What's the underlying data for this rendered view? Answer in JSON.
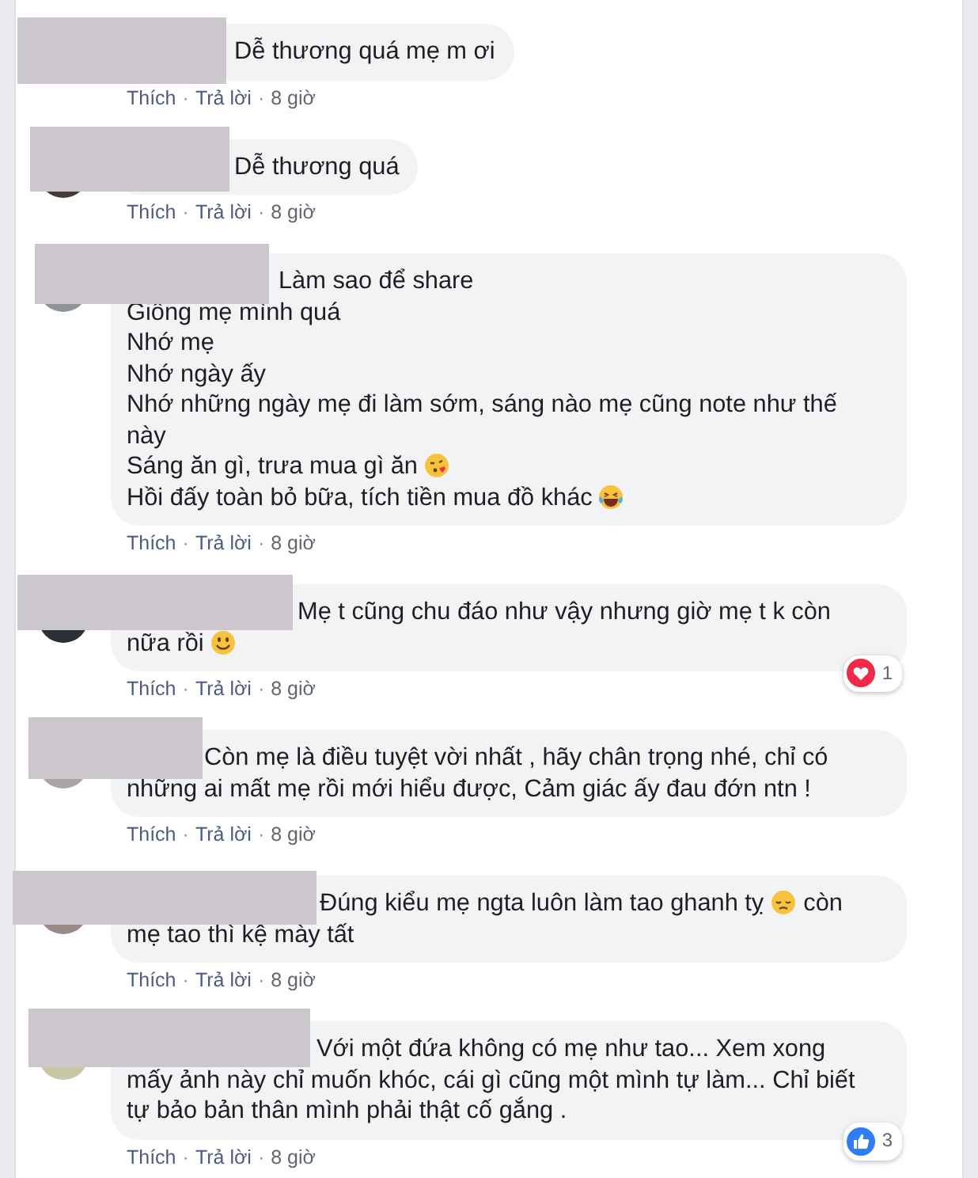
{
  "comments": [
    {
      "lines": [
        [
          {
            "kind": "text",
            "text": "Dễ thương quá mẹ m ơi"
          }
        ]
      ],
      "actions": [
        "Thích",
        "Trả lời"
      ],
      "separator": "·",
      "time": "8 giờ"
    },
    {
      "lines": [
        [
          {
            "kind": "text",
            "text": "Dễ thương quá"
          }
        ]
      ],
      "actions": [
        "Thích",
        "Trả lời"
      ],
      "separator": "·",
      "time": "8 giờ"
    },
    {
      "lines": [
        [
          {
            "kind": "text",
            "text": "Làm sao để share"
          }
        ],
        [
          {
            "kind": "text",
            "text": "Giông mẹ mình quá"
          }
        ],
        [
          {
            "kind": "text",
            "text": "Nhớ mẹ"
          }
        ],
        [
          {
            "kind": "text",
            "text": "Nhớ ngày ấy"
          }
        ],
        [
          {
            "kind": "text",
            "text": "Nhớ những ngày mẹ đi làm sớm, sáng nào mẹ cũng note như thế"
          }
        ],
        [
          {
            "kind": "text",
            "text": "này"
          }
        ],
        [
          {
            "kind": "text",
            "text": "Sáng ăn gì, trưa mua gì ăn"
          },
          {
            "kind": "kiss-emoji"
          }
        ],
        [
          {
            "kind": "text",
            "text": "Hồi đấy toàn bỏ bữa, tích tiền mua đồ khác"
          },
          {
            "kind": "laugh-emoji"
          }
        ]
      ],
      "actions": [
        "Thích",
        "Trả lời"
      ],
      "separator": "·",
      "time": "8 giờ"
    },
    {
      "lines": [
        [
          {
            "kind": "text",
            "text": "Mẹ t cũng chu đáo như vậy nhưng giờ mẹ t k còn"
          }
        ],
        [
          {
            "kind": "text",
            "text": "nữa rồi"
          },
          {
            "kind": "smile-emoji"
          }
        ]
      ],
      "reaction": {
        "kind": "heart",
        "count": "1"
      },
      "actions": [
        "Thích",
        "Trả lời"
      ],
      "separator": "·",
      "time": "8 giờ"
    },
    {
      "lines": [
        [
          {
            "kind": "text",
            "text": "Còn mẹ là điều tuyệt vời nhất , hãy chân trọng nhé, chỉ có"
          }
        ],
        [
          {
            "kind": "text",
            "text": "những ai mất mẹ rồi mới hiểu được, Cảm giác ấy đau đớn ntn !"
          }
        ]
      ],
      "actions": [
        "Thích",
        "Trả lời"
      ],
      "separator": "·",
      "time": "8 giờ"
    },
    {
      "lines": [
        [
          {
            "kind": "text",
            "text": "Đúng kiểu mẹ ngta luôn làm tao ghanh tỵ"
          },
          {
            "kind": "sad-emoji"
          },
          {
            "kind": "text",
            "text": "còn"
          }
        ],
        [
          {
            "kind": "text",
            "text": "mẹ tao thì kệ mày tất"
          }
        ]
      ],
      "actions": [
        "Thích",
        "Trả lời"
      ],
      "separator": "·",
      "time": "8 giờ"
    },
    {
      "lines": [
        [
          {
            "kind": "text",
            "text": "Với một đứa không có mẹ như tao... Xem xong"
          }
        ],
        [
          {
            "kind": "text",
            "text": "mấy ảnh này chỉ muốn khóc, cái gì cũng một mình tự làm... Chỉ biết"
          }
        ],
        [
          {
            "kind": "text",
            "text": "tự bảo bản thân mình phải thật cố gắng ."
          }
        ]
      ],
      "reaction": {
        "kind": "like",
        "count": "3"
      },
      "actions": [
        "Thích",
        "Trả lời"
      ],
      "separator": "·",
      "time": "8 giờ"
    }
  ]
}
